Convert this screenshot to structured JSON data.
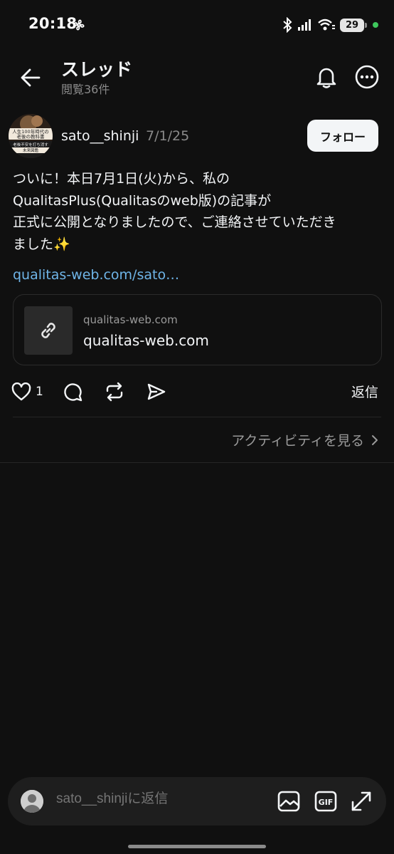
{
  "status_bar": {
    "time": "20:18",
    "battery": "29"
  },
  "header": {
    "title": "スレッド",
    "subtitle": "閲覧36件"
  },
  "post": {
    "username": "sato__shinji",
    "date": "7/1/25",
    "follow_label": "フォロー",
    "lines": [
      "ついに！本日7月1日(火)から、私の",
      "QualitasPlus(Qualitasのweb版)の記事が",
      "正式に公開となりましたので、ご連絡させていただき",
      "ました"
    ],
    "sparkle": "✨",
    "link_text": "qualitas-web.com/sato…",
    "card": {
      "domain": "qualitas-web.com",
      "title": "qualitas-web.com"
    },
    "like_count": "1",
    "reply_label": "返信",
    "activity_label": "アクティビティを見る",
    "avatar_book": {
      "line1": "人生100年時代の",
      "line2": "老後の教科書",
      "line3": "老後不安を打ち消す",
      "line4": "未来図鑑"
    }
  },
  "reply_bar": {
    "placeholder": "sato__shinjiに返信",
    "gif_label": "GIF"
  },
  "colors": {
    "background": "#101010",
    "link": "#6fb5e8",
    "muted": "#8a8a8a"
  },
  "icons": [
    "back-arrow-icon",
    "bell-icon",
    "more-icon",
    "link-icon",
    "heart-icon",
    "comment-icon",
    "repost-icon",
    "share-icon",
    "chevron-right-icon",
    "image-icon",
    "gif-icon",
    "expand-icon"
  ]
}
